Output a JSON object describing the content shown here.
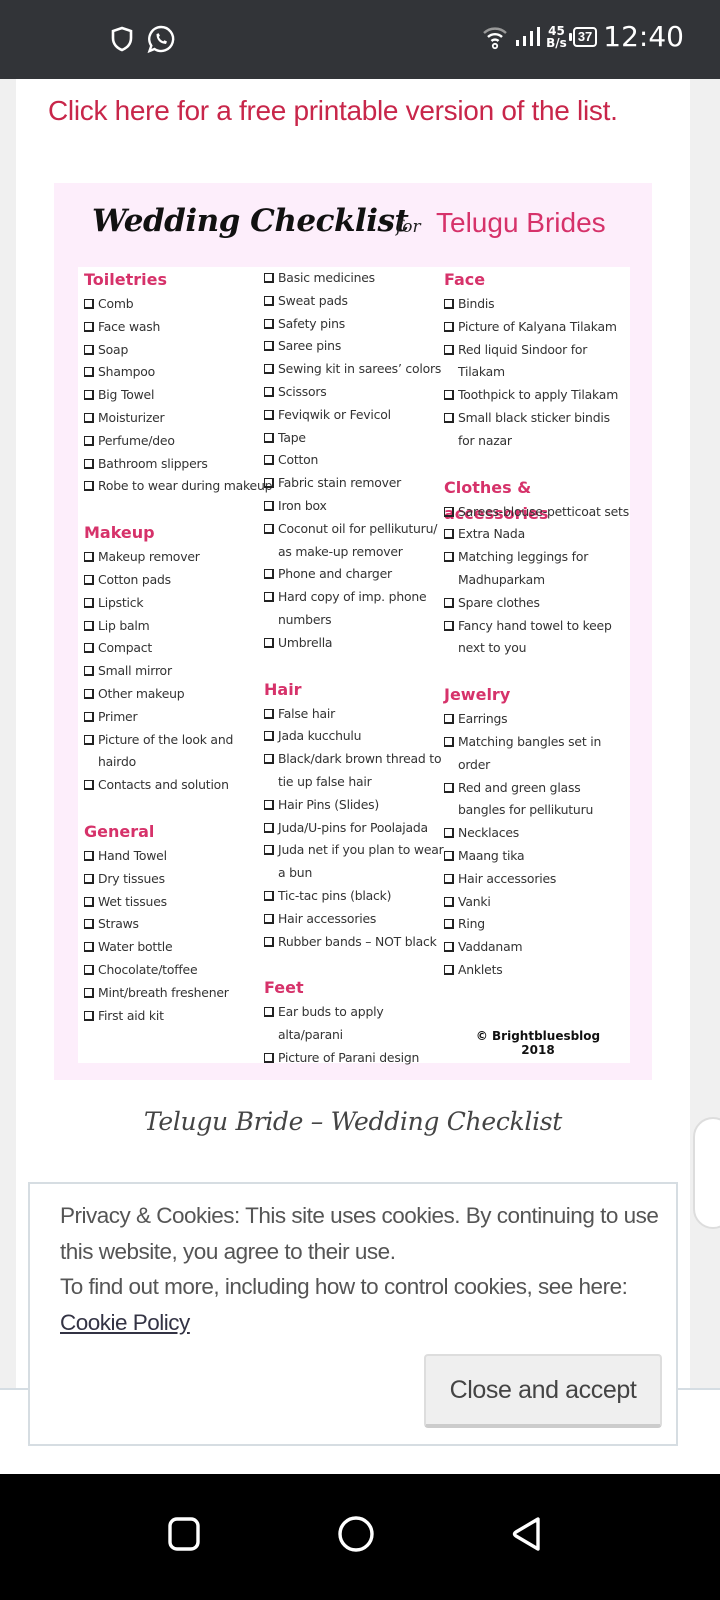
{
  "status_bar": {
    "time": "12:40",
    "battery": "37",
    "net_speed_value": "45",
    "net_speed_unit": "B/s",
    "left_icons": [
      "shield-icon",
      "whatsapp-icon"
    ],
    "right_icons": [
      "wifi-icon",
      "signal-icon",
      "battery-icon"
    ]
  },
  "page": {
    "promo_link": "Click here for a free printable version of the list.",
    "caption": "Telugu Bride – Wedding Checklist"
  },
  "checklist": {
    "title_script": "Wedding Checklist",
    "title_for": "for",
    "title_brides": "Telugu Brides",
    "copyright_line1": "© Brightbluesblog",
    "copyright_line2": "2018",
    "colors": {
      "heading": "#d6326a",
      "background": "#fdeefb"
    },
    "col1": [
      {
        "title": "Toiletries",
        "items": [
          "Comb",
          "Face wash",
          "Soap",
          "Shampoo",
          "Big Towel",
          "Moisturizer",
          "Perfume/deo",
          "Bathroom slippers",
          "Robe to wear during makeup"
        ]
      },
      {
        "title": "Makeup",
        "items": [
          "Makeup remover",
          "Cotton pads",
          "Lipstick",
          "Lip balm",
          "Compact",
          "Small mirror",
          "Other makeup",
          "Primer",
          "Picture of the look and hairdo",
          "Contacts and solution"
        ]
      },
      {
        "title": "General",
        "items": [
          "Hand Towel",
          "Dry tissues",
          "Wet tissues",
          "Straws",
          "Water bottle",
          "Chocolate/toffee",
          "Mint/breath freshener",
          "First aid kit"
        ]
      }
    ],
    "col2": [
      {
        "title": "",
        "items": [
          "Basic medicines",
          "Sweat pads",
          "Safety pins",
          "Saree pins",
          "Sewing kit in sarees’ colors",
          "Scissors",
          "Feviqwik or Fevicol",
          "Tape",
          "Cotton",
          "Fabric stain remover",
          "Iron box",
          "Coconut oil for pellikuturu/ as make-up remover",
          "Phone and charger",
          "Hard copy of imp. phone numbers",
          "Umbrella"
        ]
      },
      {
        "title": "Hair",
        "items": [
          "False hair",
          "Jada kucchulu",
          "Black/dark brown thread to tie up false hair",
          "Hair Pins (Slides)",
          "Juda/U-pins for Poolajada",
          "Juda net if you plan to wear a bun",
          "Tic-tac pins (black)",
          "Hair accessories",
          "Rubber bands – NOT black"
        ]
      },
      {
        "title": "Feet",
        "items": [
          "Ear buds to apply alta/parani",
          "Picture of Parani design"
        ]
      }
    ],
    "col3": [
      {
        "title": "Face",
        "items": [
          "Bindis",
          "Picture of Kalyana Tilakam",
          "Red liquid Sindoor for Tilakam",
          "Toothpick to apply Tilakam",
          "Small black sticker bindis for nazar"
        ]
      },
      {
        "title": "Clothes & accessories",
        "items": [
          "Sarees-blouse-petticoat sets",
          "Extra Nada",
          "Matching leggings for Madhuparkam",
          "Spare clothes",
          "Fancy hand towel to keep next to you"
        ]
      },
      {
        "title": "Jewelry",
        "items": [
          "Earrings",
          "Matching bangles set in order",
          "Red and green glass bangles for pellikuturu",
          "Necklaces",
          "Maang tika",
          "Hair accessories",
          "Vanki",
          "Ring",
          "Vaddanam",
          "Anklets"
        ]
      }
    ]
  },
  "cookie_banner": {
    "text_line1": "Privacy & Cookies: This site uses cookies. By continuing to use this website, you agree to their use.",
    "text_line2": "To find out more, including how to control cookies, see here:",
    "policy_link": "Cookie Policy",
    "button_label": "Close and accept"
  },
  "nav_bar": {
    "buttons": [
      "recents-square-icon",
      "home-circle-icon",
      "back-triangle-icon"
    ]
  }
}
